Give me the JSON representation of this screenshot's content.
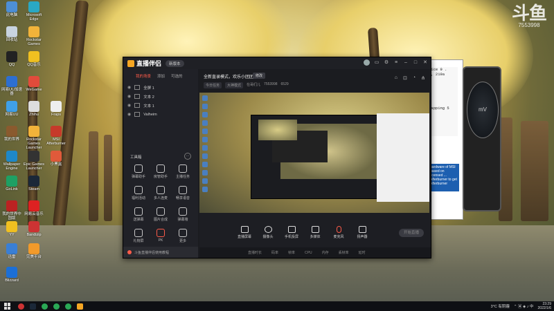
{
  "watermark": {
    "text": "斗鱼",
    "room_id": "7553998"
  },
  "desktop_icons": [
    {
      "label": "此电脑"
    },
    {
      "label": "Microsoft Edge"
    },
    {
      "label": "回收站"
    },
    {
      "label": "Rockstar Games"
    },
    {
      "label": "QQ"
    },
    {
      "label": "QQ音乐"
    },
    {
      "label": "网易UU加速器"
    },
    {
      "label": "WeGame"
    },
    {
      "label": "网易UU"
    },
    {
      "label": "Zhihu"
    },
    {
      "label": "Fraps"
    },
    {
      "label": "MSI Afterburner"
    },
    {
      "label": "我的世界"
    },
    {
      "label": "Rockstar Games Launcher"
    },
    {
      "label": "Wallpaper Engine"
    },
    {
      "label": "Epic Games Launcher"
    },
    {
      "label": "GoLink"
    },
    {
      "label": "Steam"
    },
    {
      "label": "我的世界中国版"
    },
    {
      "label": "网易云音乐"
    },
    {
      "label": "YY"
    },
    {
      "label": "Bandizip"
    },
    {
      "label": "迅雷"
    },
    {
      "label": "小黑盒"
    },
    {
      "label": "完美平台"
    },
    {
      "label": "Blizzard"
    }
  ],
  "app": {
    "name": "直播伴侣",
    "version": "新版本",
    "left_tabs": [
      "我的场景",
      "添加",
      "可选的"
    ],
    "scenes": [
      {
        "label": "全屏 1"
      },
      {
        "label": "文本 2"
      },
      {
        "label": "文本 1"
      },
      {
        "label": "Valheim"
      }
    ],
    "tools_title": "工具箱",
    "tools": [
      {
        "label": "弹幕助手"
      },
      {
        "label": "房管助手"
      },
      {
        "label": "主播任务"
      },
      {
        "label": "福利活动"
      },
      {
        "label": "多人连麦"
      },
      {
        "label": "畅享语音"
      },
      {
        "label": "送弹幕"
      },
      {
        "label": "图片合成"
      },
      {
        "label": "弹幕墙"
      },
      {
        "label": "礼物屏"
      },
      {
        "label": "PK"
      },
      {
        "label": "更多"
      }
    ],
    "left_footer": "斗鱼直播伴侣使用教程",
    "room_title": "全新直录模式，欢乐小团团",
    "edit_label": "修改",
    "room_tags": [
      "今日任务",
      "大神模式",
      "在哥们儿",
      "7553998",
      "6529"
    ],
    "bottom_tools": [
      {
        "label": "直播屏幕"
      },
      {
        "label": "摄像头"
      },
      {
        "label": "手机投屏"
      },
      {
        "label": "多媒体"
      },
      {
        "label": "麦克风"
      },
      {
        "label": "扬声器"
      }
    ],
    "start_button": "开始直播",
    "status_items": [
      "直播时长",
      "码率",
      "帧率",
      "CPU",
      "内存",
      "丢帧率",
      "延时"
    ]
  },
  "side_window": {
    "terminal_lines": [
      "Nice 9 .",
      "4, 219a",
      "",
      "",
      "",
      "",
      "",
      "",
      "",
      "napping 5"
    ],
    "ad_text": "hardware of MSI based on licensed ... Afterburner to get Afterburner"
  },
  "gauge": {
    "readout": "mV"
  },
  "taskbar": {
    "weather": "3°C 有阴霾",
    "time": "23:29",
    "date": "2022/1/6"
  }
}
